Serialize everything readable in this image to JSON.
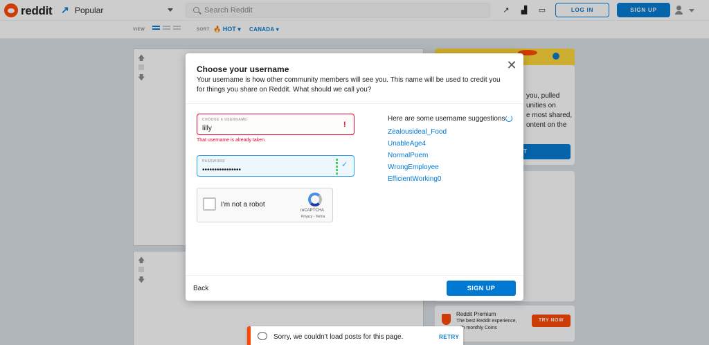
{
  "header": {
    "brand": "reddit",
    "feed_label": "Popular",
    "search_placeholder": "Search Reddit",
    "login_label": "LOG IN",
    "signup_label": "SIGN UP"
  },
  "sortbar": {
    "view_label": "VIEW",
    "sort_label": "SORT",
    "sort_value": "HOT",
    "location_value": "CANADA"
  },
  "sidebar": {
    "partial_lines": [
      "you, pulled",
      "unities on",
      "e most shared,",
      "ontent on the"
    ],
    "button_partial": "T",
    "premium": {
      "title": "Reddit Premium",
      "subtitle": "The best Reddit experience, with monthly Coins",
      "button": "TRY NOW"
    }
  },
  "toast": {
    "message": "Sorry, we couldn't load posts for this page.",
    "action": "RETRY"
  },
  "modal": {
    "title": "Choose your username",
    "description": "Your username is how other community members will see you. This name will be used to credit you for things you share on Reddit. What should we call you?",
    "username_label": "CHOOSE A USERNAME",
    "username_value": "lilly",
    "username_error": "That username is already taken",
    "password_label": "PASSWORD",
    "password_value": "••••••••••••••••",
    "captcha_text": "I'm not a robot",
    "captcha_brand": "reCAPTCHA",
    "captcha_terms": "Privacy - Terms",
    "suggestions_heading": "Here are some username suggestions",
    "suggestions": [
      "Zealousideal_Food",
      "UnableAge4",
      "NormalPoem",
      "WrongEmployee",
      "EfficientWorking0"
    ],
    "back_label": "Back",
    "signup_label": "SIGN UP"
  },
  "colors": {
    "accent": "#0079d3",
    "error": "#ea0027",
    "brand": "#ff4500",
    "valid": "#46d160"
  }
}
